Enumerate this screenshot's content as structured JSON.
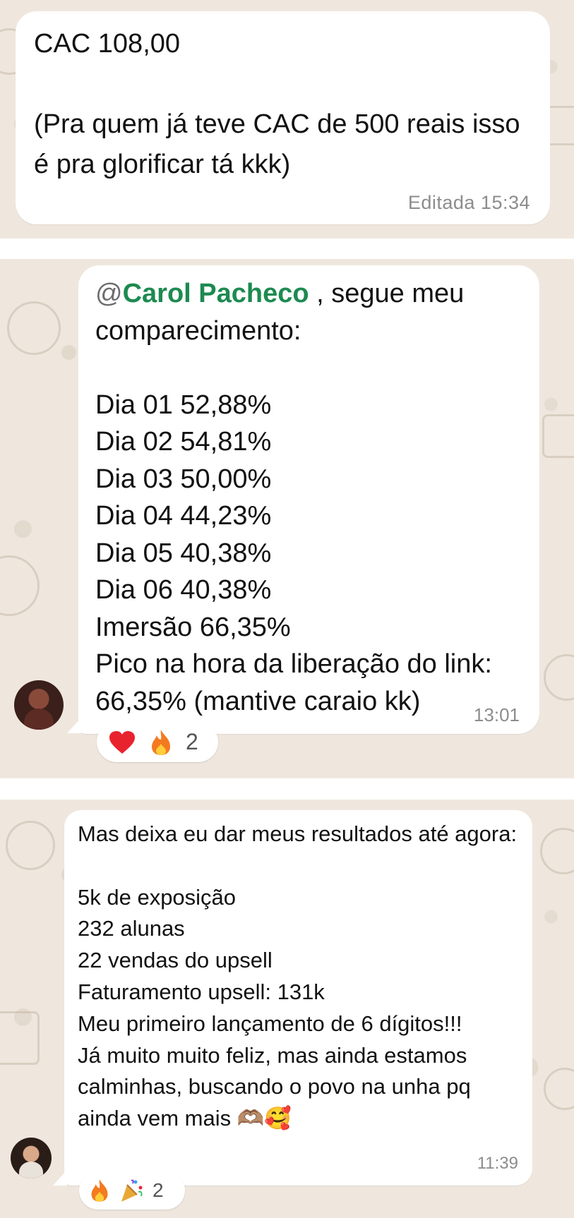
{
  "message_1": {
    "text": "CAC 108,00\n\n(Pra quem já teve CAC de 500 reais isso é pra glorificar tá kkk)",
    "timestamp": "Editada 15:34"
  },
  "message_2": {
    "mention_at": "@",
    "mention_name": "Carol Pacheco",
    "text_after_mention": " , segue meu comparecimento:\n\nDia 01 52,88%\nDia 02 54,81%\nDia 03 50,00%\nDia 04 44,23%\nDia 05 40,38%\nDia 06 40,38%\nImersão 66,35%\nPico na hora da liberação do link: 66,35% (mantive caraio kk)",
    "timestamp": "13:01",
    "reactions": {
      "emojis": [
        "heart-icon",
        "fire-icon"
      ],
      "count": "2"
    }
  },
  "message_3": {
    "text": "Mas deixa eu dar meus resultados até agora:\n\n5k de exposição\n232 alunas\n22 vendas do upsell\nFaturamento upsell: 131k\nMeu primeiro lançamento de 6 dígitos!!!\nJá muito muito feliz, mas ainda estamos calminhas, buscando o povo na unha pq ainda vem mais 🫶🏽🥰",
    "timestamp": "11:39",
    "reactions": {
      "emojis": [
        "fire-icon",
        "party-popper-icon"
      ],
      "count": "2"
    }
  },
  "colors": {
    "chat_background": "#efe7de",
    "bubble": "#ffffff",
    "mention": "#1d8a50",
    "timestamp": "#8c8c8c"
  }
}
